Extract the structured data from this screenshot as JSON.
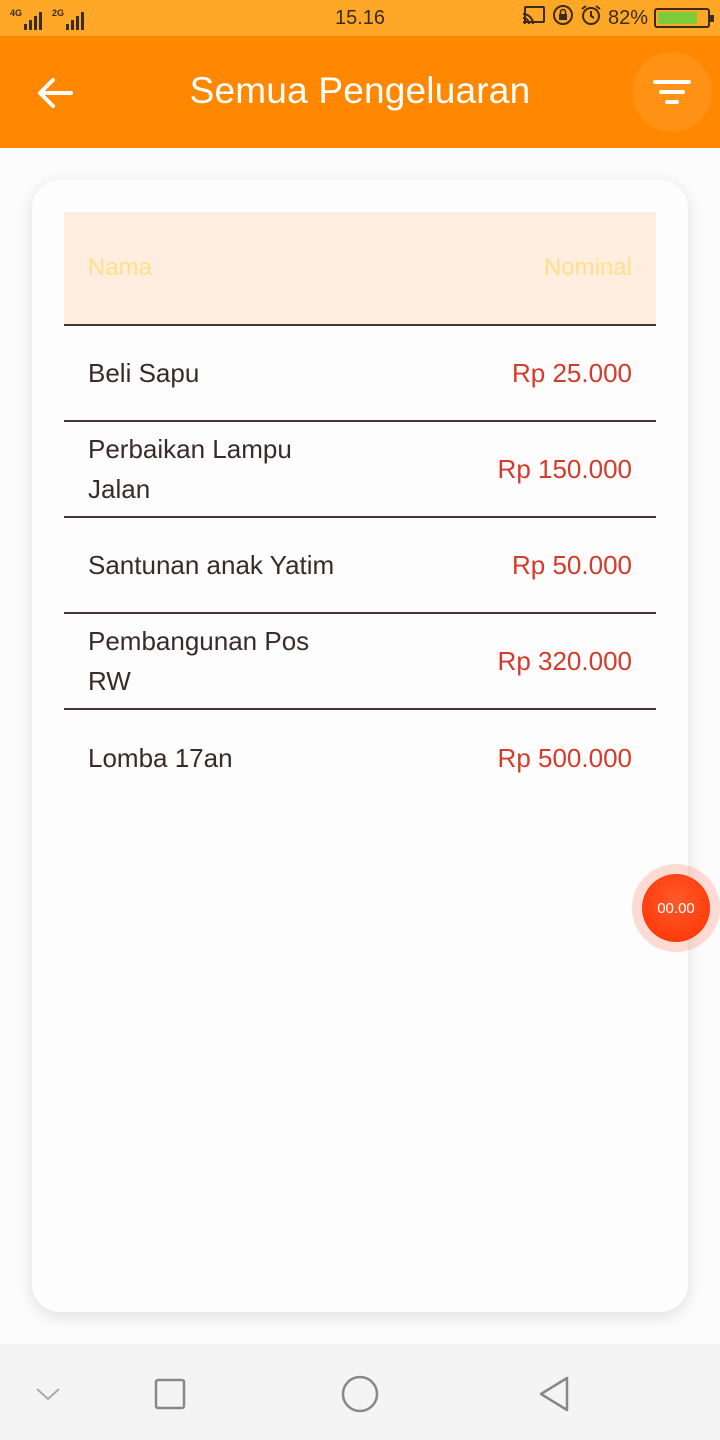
{
  "status_bar": {
    "network_1": "4G",
    "network_2": "2G",
    "time": "15.16",
    "battery": "82%"
  },
  "app_bar": {
    "title": "Semua Pengeluaran"
  },
  "table": {
    "header": {
      "name": "Nama",
      "amount": "Nominal"
    },
    "rows": [
      {
        "name": "Beli Sapu",
        "amount": "Rp 25.000"
      },
      {
        "name": "Perbaikan Lampu Jalan",
        "amount": "Rp 150.000"
      },
      {
        "name": "Santunan anak Yatim",
        "amount": "Rp 50.000"
      },
      {
        "name": "Pembangunan Pos RW",
        "amount": "Rp 320.000"
      },
      {
        "name": "Lomba 17an",
        "amount": "Rp 500.000"
      }
    ]
  },
  "floating_timer": {
    "label": "00.00"
  },
  "colors": {
    "primary": "#ff8800",
    "status_bar": "#ffa726",
    "amount": "#d63a2a",
    "header_bg": "#ffeee0",
    "header_text": "#ffe08a"
  }
}
